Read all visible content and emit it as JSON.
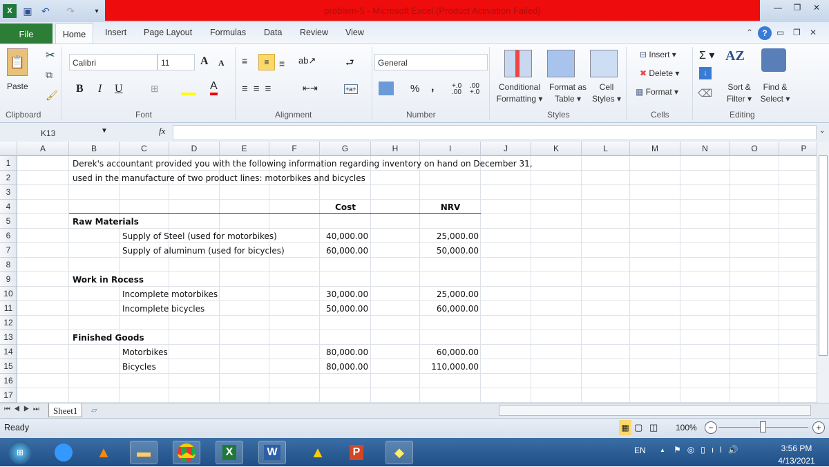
{
  "window": {
    "title": "problem-5  -  Microsoft Excel (Product Activation Failed)"
  },
  "ribbon_tabs": [
    "File",
    "Home",
    "Insert",
    "Page Layout",
    "Formulas",
    "Data",
    "Review",
    "View"
  ],
  "ribbon": {
    "clipboard": {
      "label": "Clipboard",
      "paste": "Paste"
    },
    "font": {
      "label": "Font",
      "name": "Calibri",
      "size": "11",
      "bold": "B",
      "italic": "I",
      "underline": "U"
    },
    "alignment": {
      "label": "Alignment"
    },
    "number": {
      "label": "Number",
      "format": "General",
      "percent": "%",
      "comma": ","
    },
    "styles": {
      "label": "Styles",
      "conditional": [
        "Conditional",
        "Formatting ▾"
      ],
      "format_table": [
        "Format as",
        "Table ▾"
      ],
      "cell_styles": [
        "Cell",
        "Styles ▾"
      ]
    },
    "cells": {
      "label": "Cells",
      "insert": "Insert ▾",
      "delete": "Delete ▾",
      "format": "Format ▾"
    },
    "editing": {
      "label": "Editing",
      "sort": [
        "Sort &",
        "Filter ▾"
      ],
      "find": [
        "Find &",
        "Select ▾"
      ]
    }
  },
  "formula_bar": {
    "name_box": "K13",
    "fx": "fx",
    "value": ""
  },
  "columns": [
    "A",
    "B",
    "C",
    "D",
    "E",
    "F",
    "G",
    "H",
    "I",
    "J",
    "K",
    "L",
    "M",
    "N",
    "O",
    "P"
  ],
  "rows": [
    "1",
    "2",
    "3",
    "4",
    "5",
    "6",
    "7",
    "8",
    "9",
    "10",
    "11",
    "12",
    "13",
    "14",
    "15",
    "16",
    "17"
  ],
  "sheet": {
    "intro_line1": "Derek's accountant provided you with the following information regarding inventory on hand on December 31,",
    "intro_line2": "used in the manufacture of two product lines: motorbikes and bicycles",
    "header_cost": "Cost",
    "header_nrv": "NRV",
    "sections": [
      {
        "title": "Raw Materials",
        "row": 5,
        "items": [
          {
            "row": 6,
            "name": "Supply of Steel (used for motorbikes)",
            "cost": "40,000.00",
            "nrv": "25,000.00"
          },
          {
            "row": 7,
            "name": "Supply of aluminum (used for bicycles)",
            "cost": "60,000.00",
            "nrv": "50,000.00"
          }
        ]
      },
      {
        "title": "Work in Rocess",
        "row": 9,
        "items": [
          {
            "row": 10,
            "name": "Incomplete motorbikes",
            "cost": "30,000.00",
            "nrv": "25,000.00"
          },
          {
            "row": 11,
            "name": "Incomplete bicycles",
            "cost": "50,000.00",
            "nrv": "60,000.00"
          }
        ]
      },
      {
        "title": "Finished Goods",
        "row": 13,
        "items": [
          {
            "row": 14,
            "name": "Motorbikes",
            "cost": "80,000.00",
            "nrv": "60,000.00"
          },
          {
            "row": 15,
            "name": "Bicycles",
            "cost": "80,000.00",
            "nrv": "110,000.00"
          }
        ]
      }
    ]
  },
  "sheet_tabs": [
    "Sheet1"
  ],
  "status": {
    "text": "Ready",
    "zoom": "100%",
    "zoom_level": 100
  },
  "taskbar": {
    "lang": "EN",
    "time": "3:56 PM",
    "date": "4/13/2021"
  },
  "colors": {
    "title_band": "#ee0c0c",
    "file_tab": "#2c7d35",
    "taskbar": "#2a5d96"
  }
}
